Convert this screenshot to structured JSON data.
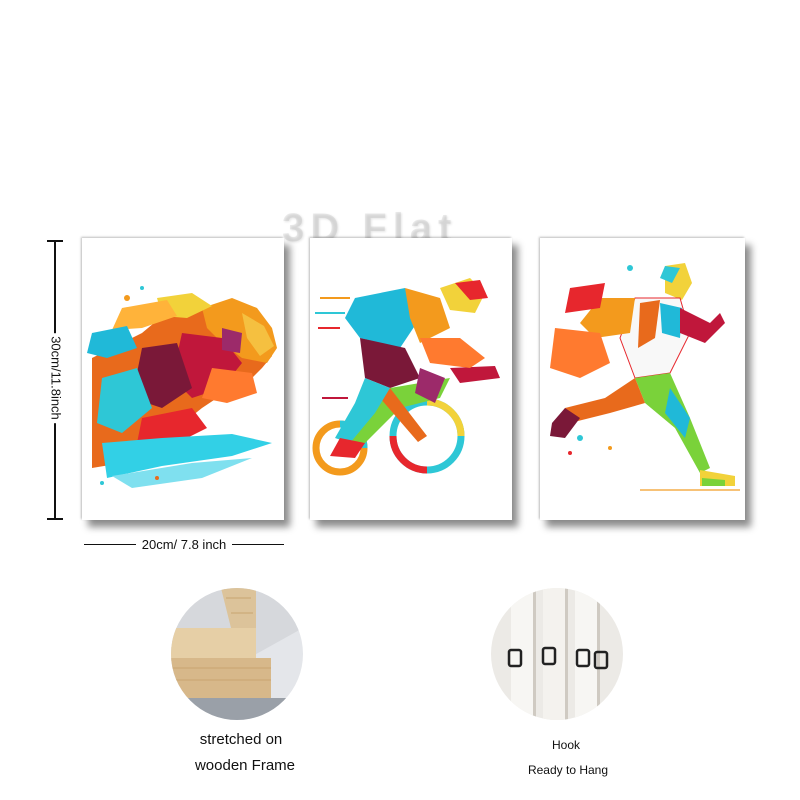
{
  "watermark": "3D Flat",
  "dimensions": {
    "height_label": "30cm/11.8inch",
    "width_label": "20cm/ 7.8 inch"
  },
  "panels": [
    {
      "subject": "swimmer-artwork"
    },
    {
      "subject": "cyclist-artwork"
    },
    {
      "subject": "runner-artwork"
    }
  ],
  "features": {
    "frame": {
      "line1": "stretched on",
      "line2": "wooden Frame"
    },
    "hook": {
      "line1": "Hook",
      "line2": "Ready to Hang"
    }
  }
}
